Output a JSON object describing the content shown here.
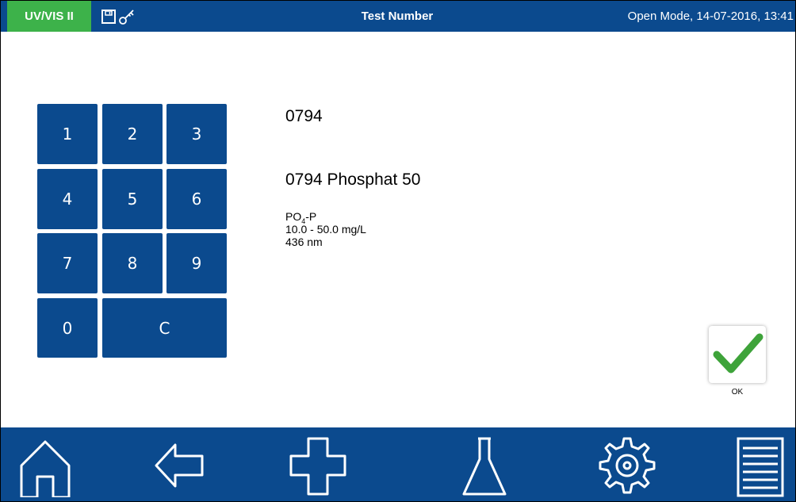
{
  "header": {
    "device": "UV/VIS II",
    "title": "Test Number",
    "status": "Open Mode, 14-07-2016, 13:41",
    "icons": [
      "save-icon",
      "key-icon"
    ]
  },
  "keypad": {
    "keys": [
      "1",
      "2",
      "3",
      "4",
      "5",
      "6",
      "7",
      "8",
      "9",
      "0",
      "C"
    ]
  },
  "test": {
    "entry": "0794",
    "name": "0794 Phosphat 50",
    "formula_main": "PO",
    "formula_sub": "4",
    "formula_suffix": "-P",
    "range": "10.0 - 50.0 mg/L",
    "wavelength": "436 nm"
  },
  "ok": {
    "label": "OK",
    "icon": "checkmark-icon",
    "color": "#3ea33a"
  },
  "nav": {
    "icons": [
      "home-icon",
      "back-arrow-icon",
      "plus-icon",
      "flask-icon",
      "gear-icon",
      "list-icon"
    ]
  },
  "colors": {
    "primary": "#0b4a8e",
    "badge": "#3db24a"
  }
}
